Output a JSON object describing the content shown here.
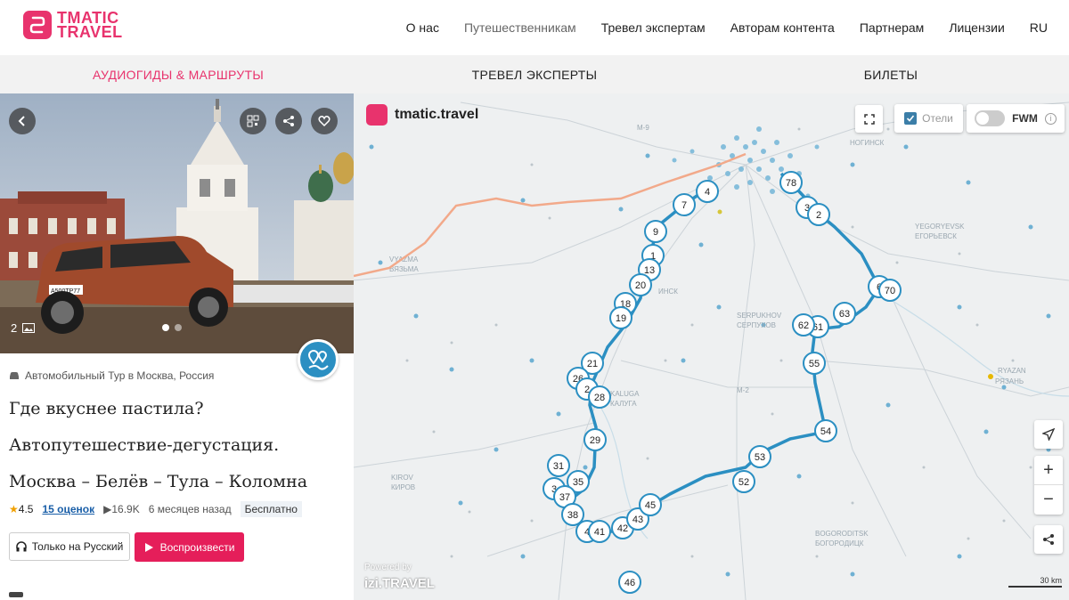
{
  "brand": {
    "line1": "TMATIC",
    "line2": "TRAVEL",
    "accent": "#e8336d"
  },
  "nav": [
    {
      "label": "О нас"
    },
    {
      "label": "Путешественникам"
    },
    {
      "label": "Тревел экспертам"
    },
    {
      "label": "Авторам контента"
    },
    {
      "label": "Партнерам"
    },
    {
      "label": "Лицензии"
    },
    {
      "label": "RU"
    }
  ],
  "subnav": [
    {
      "label": "АУДИОГИДЫ & МАРШРУТЫ",
      "active": true
    },
    {
      "label": "ТРЕВЕЛ ЭКСПЕРТЫ"
    },
    {
      "label": "БИЛЕТЫ"
    }
  ],
  "gallery": {
    "count": "2",
    "plate": "А500ТР77"
  },
  "tour": {
    "type": "Автомобильный Тур в Москва, Россия",
    "title_line1": "Где вкуснее пастила?",
    "title_line2": "Автопутешествие-дегустация.",
    "title_line3": "Москва – Белёв – Тула – Коломна",
    "rating": "4.5",
    "rating_count": "15 оценок",
    "plays": "16.9K",
    "age": "6 месяцев назад",
    "price": "Бесплатно"
  },
  "buttons": {
    "language": "Только на Русский",
    "play": "Воспроизвести"
  },
  "map": {
    "logo": "tmatic.travel",
    "hotels_label": "Отели",
    "fwm_label": "FWM",
    "powered_by": "Powered by",
    "izi": "izi.TRAVEL",
    "scale": "30 km",
    "route_color": "#2b8fc2",
    "labels": [
      "M-9",
      "НОГИНСК",
      "YEGORYEVSK",
      "ЕГОРЬЕВСК",
      "VYAZMA",
      "ВЯЗЬМА",
      "SERPUKHOV",
      "СЕРПУХОВ",
      "KALUGA",
      "КАЛУГА",
      "M-2",
      "RYAZAN",
      "РЯЗАНЬ",
      "KIROV",
      "КИРОВ",
      "BOGORODITSK",
      "БОГОРОДИЦК",
      "ИНСК"
    ],
    "markers": [
      "78",
      "3",
      "2",
      "7",
      "4",
      "9",
      "1",
      "13",
      "20",
      "18",
      "19",
      "21",
      "26",
      "2",
      "28",
      "29",
      "31",
      "35",
      "3",
      "37",
      "38",
      "4",
      "41",
      "42",
      "43",
      "45",
      "46",
      "52",
      "53",
      "54",
      "55",
      "61",
      "62",
      "63",
      "6",
      "70"
    ]
  }
}
